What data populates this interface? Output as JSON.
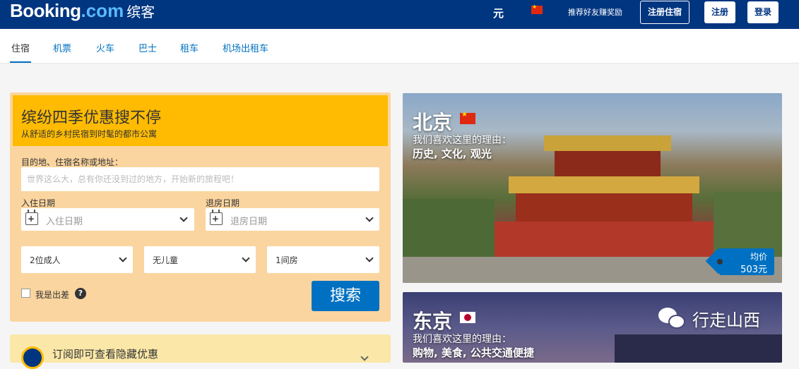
{
  "header": {
    "logo_brand": "Booking",
    "logo_com": ".com",
    "logo_cn": "缤客",
    "currency": "元",
    "referral": "推荐好友赚奖励",
    "list_property": "注册住宿",
    "register": "注册",
    "login": "登录"
  },
  "nav": {
    "items": [
      "住宿",
      "机票",
      "火车",
      "巴士",
      "租车",
      "机场出租车"
    ],
    "active": "住宿"
  },
  "search": {
    "title": "缤纷四季优惠搜不停",
    "subtitle": "从舒适的乡村民宿到时髦的都市公寓",
    "dest_label": "目的地、住宿名称或地址：",
    "dest_placeholder": "世界这么大，总有你还没到过的地方，开始新的旅程吧！",
    "checkin_label": "入住日期",
    "checkin_placeholder": "入住日期",
    "checkout_label": "退房日期",
    "checkout_placeholder": "退房日期",
    "adults": "2位成人",
    "children": "无儿童",
    "rooms": "1间房",
    "business_label": "我是出差",
    "search_button": "搜索"
  },
  "subscribe": {
    "text": "订阅即可查看隐藏优惠"
  },
  "destinations": [
    {
      "city": "北京",
      "reason_label": "我们喜欢这里的理由：",
      "tags": "历史, 文化, 观光",
      "price_label": "均价",
      "price": "503元"
    },
    {
      "city": "东京",
      "reason_label": "我们喜欢这里的理由：",
      "tags": "购物, 美食, 公共交通便捷"
    }
  ],
  "watermark": "行走山西",
  "colors": {
    "brand_dark": "#003580",
    "brand_link": "#0071c2",
    "accent_yellow": "#febb02"
  }
}
